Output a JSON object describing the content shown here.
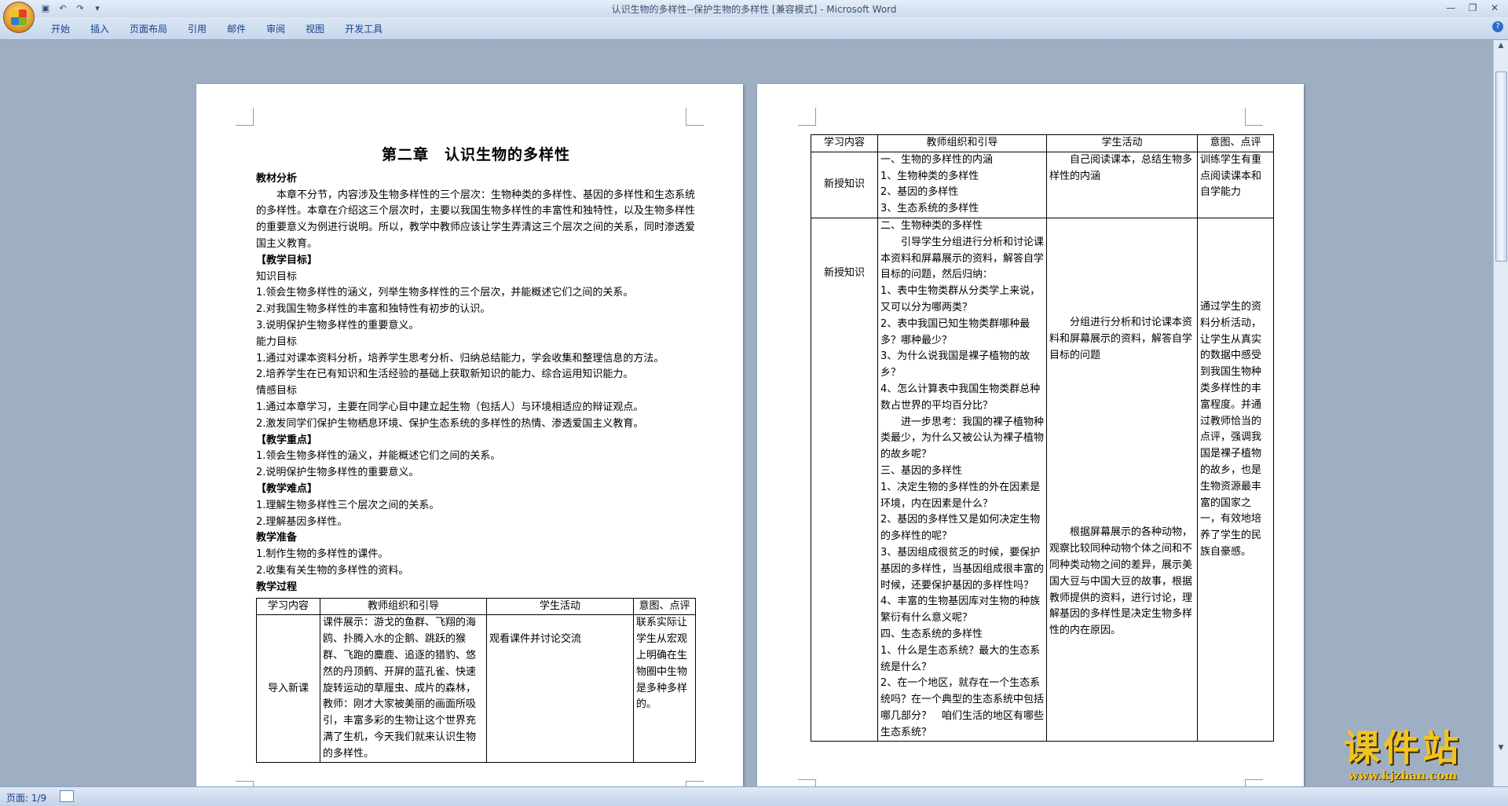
{
  "window": {
    "title": "认识生物的多样性--保护生物的多样性 [兼容模式] - Microsoft Word"
  },
  "ribbon": {
    "tabs": [
      "开始",
      "插入",
      "页面布局",
      "引用",
      "邮件",
      "审阅",
      "视图",
      "开发工具"
    ]
  },
  "status": {
    "page": "页面: 1/9"
  },
  "page1": {
    "chapter_title": "第二章　认识生物的多样性",
    "lines": [
      {
        "text": "教材分析",
        "style": "bold"
      },
      {
        "text": "本章不分节，内容涉及生物多样性的三个层次：生物种类的多样性、基因的多样性和生态系统的多样性。本章在介绍这三个层次时，主要以我国生物多样性的丰富性和独特性，以及生物多样性的重要意义为例进行说明。所以，教学中教师应该让学生弄清这三个层次之间的关系，同时渗透爱国主义教育。",
        "style": "indent"
      },
      {
        "text": "【教学目标】",
        "style": "bold"
      },
      {
        "text": "知识目标",
        "style": ""
      },
      {
        "text": "1.领会生物多样性的涵义，列举生物多样性的三个层次，并能概述它们之间的关系。",
        "style": ""
      },
      {
        "text": "2.对我国生物多样性的丰富和独特性有初步的认识。",
        "style": ""
      },
      {
        "text": "3.说明保护生物多样性的重要意义。",
        "style": ""
      },
      {
        "text": "能力目标",
        "style": ""
      },
      {
        "text": "1.通过对课本资料分析，培养学生思考分析、归纳总结能力，学会收集和整理信息的方法。",
        "style": ""
      },
      {
        "text": "2.培养学生在已有知识和生活经验的基础上获取新知识的能力、综合运用知识能力。",
        "style": ""
      },
      {
        "text": "情感目标",
        "style": ""
      },
      {
        "text": "1.通过本章学习，主要在同学心目中建立起生物（包括人）与环境相适应的辩证观点。",
        "style": ""
      },
      {
        "text": "2.激发同学们保护生物栖息环境、保护生态系统的多样性的热情、渗透爱国主义教育。",
        "style": ""
      },
      {
        "text": "【教学重点】",
        "style": "bold"
      },
      {
        "text": "1.领会生物多样性的涵义，并能概述它们之间的关系。",
        "style": ""
      },
      {
        "text": "2.说明保护生物多样性的重要意义。",
        "style": ""
      },
      {
        "text": "【教学难点】",
        "style": "bold"
      },
      {
        "text": "1.理解生物多样性三个层次之间的关系。",
        "style": ""
      },
      {
        "text": "2.理解基因多样性。",
        "style": ""
      },
      {
        "text": "教学准备",
        "style": "bold"
      },
      {
        "text": "1.制作生物的多样性的课件。",
        "style": ""
      },
      {
        "text": "2.收集有关生物的多样性的资料。",
        "style": ""
      },
      {
        "text": "教学过程",
        "style": "bold"
      }
    ],
    "table": {
      "headers": [
        "学习内容",
        "教师组织和引导",
        "学生活动",
        "意图、点评"
      ],
      "rows": [
        {
          "content": "导入新课",
          "teacher": "课件展示：游戈的鱼群、飞翔的海鸥、扑腾入水的企鹅、跳跃的猴群、飞跑的麋鹿、追逐的猎豹、悠然的丹顶鹤、开屏的蓝孔雀、快速旋转运动的草履虫、成片的森林，教师：刚才大家被美丽的画面所吸引，丰富多彩的生物让这个世界充满了生机，今天我们就来认识生物的多样性。",
          "student": "观看课件并讨论交流",
          "comment": "联系实际让学生从宏观上明确在生物圈中生物是多种多样的。"
        }
      ]
    }
  },
  "page2": {
    "table": {
      "headers": [
        "学习内容",
        "教师组织和引导",
        "学生活动",
        "意图、点评"
      ],
      "rows": [
        {
          "content": "新授知识",
          "teacher": [
            "一、生物的多样性的内涵",
            "1、生物种类的多样性",
            "2、基因的多样性",
            "3、生态系统的多样性"
          ],
          "student": "自己阅读课本，总结生物多样性的内涵",
          "comment": "训练学生有重点阅读课本和自学能力"
        },
        {
          "content": "新授知识",
          "teacher": [
            "二、生物种类的多样性",
            "　　引导学生分组进行分析和讨论课本资料和屏幕展示的资料，解答自学目标的问题，然后归纳：",
            "1、表中生物类群从分类学上来说，又可以分为哪两类？",
            "2、表中我国已知生物类群哪种最多？哪种最少？",
            "3、为什么说我国是裸子植物的故乡？",
            "4、怎么计算表中我国生物类群总种数占世界的平均百分比？",
            "　　进一步思考：我国的裸子植物种类最少，为什么又被公认为裸子植物的故乡呢？",
            "三、基因的多样性",
            "1、决定生物的多样性的外在因素是环境，内在因素是什么？",
            "2、基因的多样性又是如何决定生物的多样性的呢？",
            "3、基因组成很贫乏的时候，要保护基因的多样性，当基因组成很丰富的时候，还要保护基因的多样性吗？",
            "4、丰富的生物基因库对生物的种族繁衍有什么意义呢？",
            "四、生态系统的多样性",
            "1、什么是生态系统？最大的生态系统是什么？",
            "2、在一个地区，就存在一个生态系统吗？在一个典型的生态系统中包括哪几部分？　咱们生活的地区有哪些生态系统？"
          ],
          "student_a": "分组进行分析和讨论课本资料和屏幕展示的资料，解答自学目标的问题",
          "student_b": "根据屏幕展示的各种动物，观察比较同种动物个体之间和不同种类动物之间的差异，展示美国大豆与中国大豆的故事，根据教师提供的资料，进行讨论，理解基因的多样性是决定生物多样性的内在原因。",
          "comment": "通过学生的资料分析活动，让学生从真实的数据中感受到我国生物种类多样性的丰富程度。并通过教师恰当的点评，强调我国是裸子植物的故乡，也是生物资源最丰富的国家之一，有效地培养了学生的民族自豪感。"
        }
      ]
    }
  },
  "watermark": {
    "brand": "课件站",
    "url": "www.kjzhan.com"
  }
}
